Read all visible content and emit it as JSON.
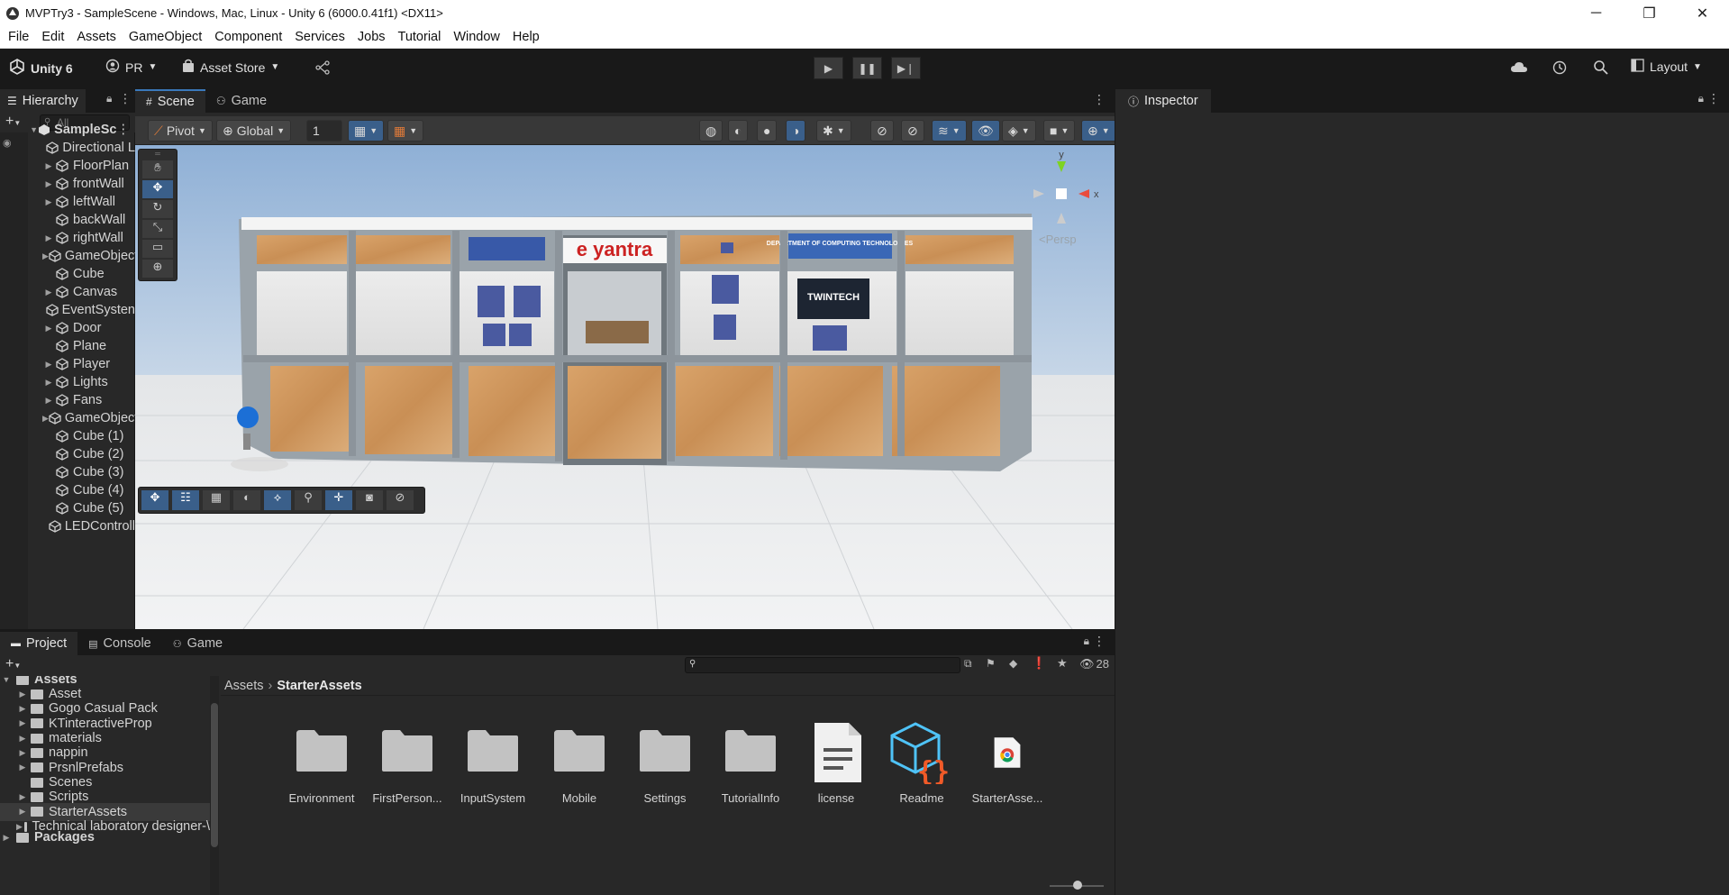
{
  "window": {
    "title": "MVPTry3 - SampleScene - Windows, Mac, Linux - Unity 6 (6000.0.41f1) <DX11>",
    "minimize": "─",
    "maximize": "❐",
    "close": "✕"
  },
  "menu": [
    "File",
    "Edit",
    "Assets",
    "GameObject",
    "Component",
    "Services",
    "Jobs",
    "Tutorial",
    "Window",
    "Help"
  ],
  "toolbar": {
    "unity_label": "Unity 6",
    "account_label": "PR",
    "asset_store_label": "Asset Store",
    "layout_label": "Layout"
  },
  "hierarchy": {
    "tab_label": "Hierarchy",
    "search_placeholder": "All",
    "scene_name": "SampleSc",
    "items": [
      {
        "label": "Directional L",
        "arrow": ""
      },
      {
        "label": "FloorPlan",
        "arrow": "▶"
      },
      {
        "label": "frontWall",
        "arrow": "▶"
      },
      {
        "label": "leftWall",
        "arrow": "▶"
      },
      {
        "label": "backWall",
        "arrow": ""
      },
      {
        "label": "rightWall",
        "arrow": "▶"
      },
      {
        "label": "GameObject",
        "arrow": "▶"
      },
      {
        "label": "Cube",
        "arrow": ""
      },
      {
        "label": "Canvas",
        "arrow": "▶"
      },
      {
        "label": "EventSysten",
        "arrow": ""
      },
      {
        "label": "Door",
        "arrow": "▶"
      },
      {
        "label": "Plane",
        "arrow": ""
      },
      {
        "label": "Player",
        "arrow": "▶"
      },
      {
        "label": "Lights",
        "arrow": "▶"
      },
      {
        "label": "Fans",
        "arrow": "▶"
      },
      {
        "label": "GameObject",
        "arrow": "▶"
      },
      {
        "label": "Cube (1)",
        "arrow": ""
      },
      {
        "label": "Cube (2)",
        "arrow": ""
      },
      {
        "label": "Cube (3)",
        "arrow": ""
      },
      {
        "label": "Cube (4)",
        "arrow": ""
      },
      {
        "label": "Cube (5)",
        "arrow": ""
      },
      {
        "label": "LEDControll",
        "arrow": ""
      }
    ]
  },
  "scene": {
    "tab_scene": "Scene",
    "tab_game": "Game",
    "pivot_label": "Pivot",
    "global_label": "Global",
    "grid_value": "1",
    "persp_label": "<Persp",
    "gizmo_y": "y",
    "gizmo_x": "x",
    "sign_brand": "e yantra",
    "sign_dept": "DEPARTMENT OF COMPUTING TECHNOLOGIES",
    "sign_twintech": "TWINTECH"
  },
  "inspector": {
    "tab_label": "Inspector"
  },
  "project": {
    "tab_project": "Project",
    "tab_console": "Console",
    "tab_game": "Game",
    "count": "28",
    "breadcrumb_root": "Assets",
    "breadcrumb_current": "StarterAssets",
    "tree_root": "Assets",
    "tree": [
      {
        "label": "Asset",
        "arrow": "▶"
      },
      {
        "label": "Gogo Casual Pack",
        "arrow": "▶"
      },
      {
        "label": "KTinteractiveProp",
        "arrow": "▶"
      },
      {
        "label": "materials",
        "arrow": "▶"
      },
      {
        "label": "nappin",
        "arrow": "▶"
      },
      {
        "label": "PrsnlPrefabs",
        "arrow": "▶"
      },
      {
        "label": "Scenes",
        "arrow": ""
      },
      {
        "label": "Scripts",
        "arrow": "▶"
      },
      {
        "label": "StarterAssets",
        "arrow": "▶"
      },
      {
        "label": "Technical laboratory designer-\\",
        "arrow": "▶"
      }
    ],
    "packages_label": "Packages",
    "assets": [
      {
        "label": "Environment",
        "kind": "folder"
      },
      {
        "label": "FirstPerson...",
        "kind": "folder"
      },
      {
        "label": "InputSystem",
        "kind": "folder"
      },
      {
        "label": "Mobile",
        "kind": "folder"
      },
      {
        "label": "Settings",
        "kind": "folder"
      },
      {
        "label": "TutorialInfo",
        "kind": "folder"
      },
      {
        "label": "license",
        "kind": "text"
      },
      {
        "label": "Readme",
        "kind": "script"
      },
      {
        "label": "StarterAsse...",
        "kind": "html"
      }
    ]
  },
  "colors": {
    "accent": "#3a79bb",
    "panel": "#282828",
    "toolbar": "#191919",
    "folder": "#c2c2c2"
  }
}
